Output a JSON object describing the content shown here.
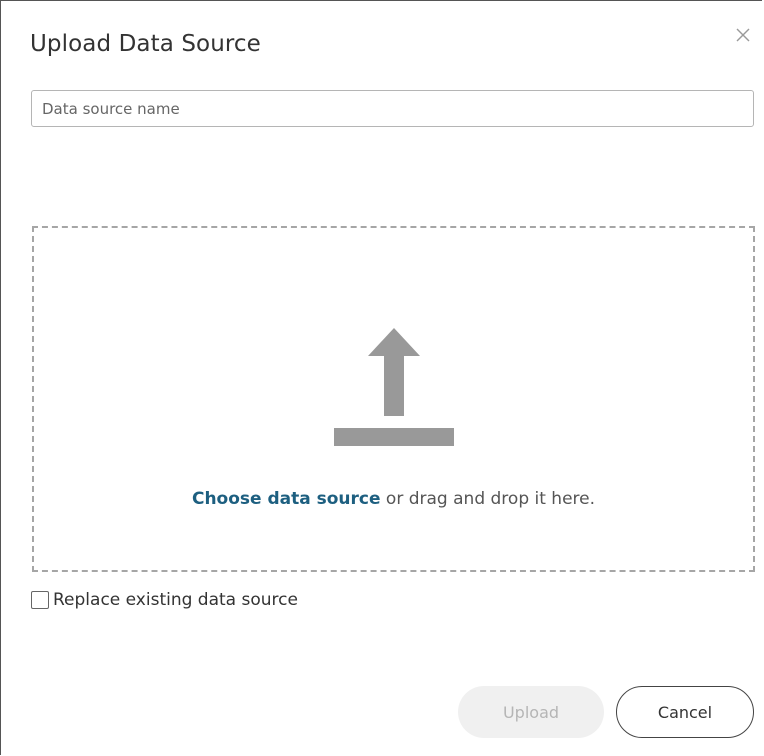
{
  "dialog": {
    "title": "Upload Data Source",
    "close_icon": "close-icon"
  },
  "name_input": {
    "value": "",
    "placeholder": "Data source name"
  },
  "dropzone": {
    "icon": "upload-arrow-icon",
    "link_text": "Choose data source",
    "rest_text": " or drag and drop it here."
  },
  "replace_option": {
    "checked": false,
    "label": "Replace existing data source"
  },
  "buttons": {
    "upload_label": "Upload",
    "upload_enabled": false,
    "cancel_label": "Cancel"
  },
  "colors": {
    "link": "#1d5f80",
    "icon": "#999999",
    "dash_border": "#a6a6a6",
    "disabled_button_bg": "#f0f0f0",
    "disabled_button_text": "#b5b5b5"
  }
}
